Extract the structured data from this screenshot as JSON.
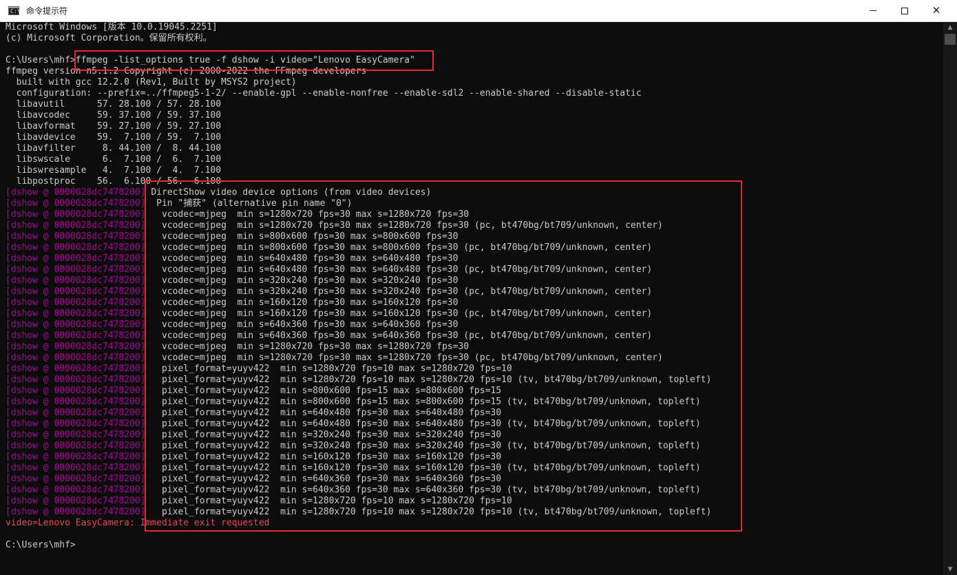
{
  "window": {
    "title": "命令提示符",
    "icon": "cmd-icon",
    "icon_glyph": "C:\\",
    "controls": {
      "minimize": "minimize-icon",
      "maximize": "maximize-icon",
      "close": "close-icon",
      "close_glyph": "✕"
    }
  },
  "colors": {
    "background": "#0c0c0c",
    "text": "#cccccc",
    "dshow_prefix": "#b4009e",
    "error": "#e74856",
    "highlight": "#e8292e"
  },
  "console": {
    "lines": [
      {
        "text": "Microsoft Windows [版本 10.0.19045.2251]"
      },
      {
        "text": "(c) Microsoft Corporation。保留所有权利。"
      },
      {
        "text": ""
      },
      {
        "text": "C:\\Users\\mhf>ffmpeg -list_options true -f dshow -i video=\"Lenovo EasyCamera\""
      },
      {
        "text": "ffmpeg version n5.1.2 Copyright (c) 2000-2022 the FFmpeg developers"
      },
      {
        "text": "  built with gcc 12.2.0 (Rev1, Built by MSYS2 project)"
      },
      {
        "text": "  configuration: --prefix=../ffmpeg5-1-2/ --enable-gpl --enable-nonfree --enable-sdl2 --enable-shared --disable-static"
      },
      {
        "text": "  libavutil      57. 28.100 / 57. 28.100"
      },
      {
        "text": "  libavcodec     59. 37.100 / 59. 37.100"
      },
      {
        "text": "  libavformat    59. 27.100 / 59. 27.100"
      },
      {
        "text": "  libavdevice    59.  7.100 / 59.  7.100"
      },
      {
        "text": "  libavfilter     8. 44.100 /  8. 44.100"
      },
      {
        "text": "  libswscale      6.  7.100 /  6.  7.100"
      },
      {
        "text": "  libswresample   4.  7.100 /  4.  7.100"
      },
      {
        "text": "  libpostproc    56.  6.100 / 56.  6.100"
      },
      {
        "prefix": "[dshow @ 0000028dc7478200]",
        "text": " DirectShow video device options (from video devices)"
      },
      {
        "prefix": "[dshow @ 0000028dc7478200]",
        "text": "  Pin \"捕获\" (alternative pin name \"0\")"
      },
      {
        "prefix": "[dshow @ 0000028dc7478200]",
        "text": "   vcodec=mjpeg  min s=1280x720 fps=30 max s=1280x720 fps=30"
      },
      {
        "prefix": "[dshow @ 0000028dc7478200]",
        "text": "   vcodec=mjpeg  min s=1280x720 fps=30 max s=1280x720 fps=30 (pc, bt470bg/bt709/unknown, center)"
      },
      {
        "prefix": "[dshow @ 0000028dc7478200]",
        "text": "   vcodec=mjpeg  min s=800x600 fps=30 max s=800x600 fps=30"
      },
      {
        "prefix": "[dshow @ 0000028dc7478200]",
        "text": "   vcodec=mjpeg  min s=800x600 fps=30 max s=800x600 fps=30 (pc, bt470bg/bt709/unknown, center)"
      },
      {
        "prefix": "[dshow @ 0000028dc7478200]",
        "text": "   vcodec=mjpeg  min s=640x480 fps=30 max s=640x480 fps=30"
      },
      {
        "prefix": "[dshow @ 0000028dc7478200]",
        "text": "   vcodec=mjpeg  min s=640x480 fps=30 max s=640x480 fps=30 (pc, bt470bg/bt709/unknown, center)"
      },
      {
        "prefix": "[dshow @ 0000028dc7478200]",
        "text": "   vcodec=mjpeg  min s=320x240 fps=30 max s=320x240 fps=30"
      },
      {
        "prefix": "[dshow @ 0000028dc7478200]",
        "text": "   vcodec=mjpeg  min s=320x240 fps=30 max s=320x240 fps=30 (pc, bt470bg/bt709/unknown, center)"
      },
      {
        "prefix": "[dshow @ 0000028dc7478200]",
        "text": "   vcodec=mjpeg  min s=160x120 fps=30 max s=160x120 fps=30"
      },
      {
        "prefix": "[dshow @ 0000028dc7478200]",
        "text": "   vcodec=mjpeg  min s=160x120 fps=30 max s=160x120 fps=30 (pc, bt470bg/bt709/unknown, center)"
      },
      {
        "prefix": "[dshow @ 0000028dc7478200]",
        "text": "   vcodec=mjpeg  min s=640x360 fps=30 max s=640x360 fps=30"
      },
      {
        "prefix": "[dshow @ 0000028dc7478200]",
        "text": "   vcodec=mjpeg  min s=640x360 fps=30 max s=640x360 fps=30 (pc, bt470bg/bt709/unknown, center)"
      },
      {
        "prefix": "[dshow @ 0000028dc7478200]",
        "text": "   vcodec=mjpeg  min s=1280x720 fps=30 max s=1280x720 fps=30"
      },
      {
        "prefix": "[dshow @ 0000028dc7478200]",
        "text": "   vcodec=mjpeg  min s=1280x720 fps=30 max s=1280x720 fps=30 (pc, bt470bg/bt709/unknown, center)"
      },
      {
        "prefix": "[dshow @ 0000028dc7478200]",
        "text": "   pixel_format=yuyv422  min s=1280x720 fps=10 max s=1280x720 fps=10"
      },
      {
        "prefix": "[dshow @ 0000028dc7478200]",
        "text": "   pixel_format=yuyv422  min s=1280x720 fps=10 max s=1280x720 fps=10 (tv, bt470bg/bt709/unknown, topleft)"
      },
      {
        "prefix": "[dshow @ 0000028dc7478200]",
        "text": "   pixel_format=yuyv422  min s=800x600 fps=15 max s=800x600 fps=15"
      },
      {
        "prefix": "[dshow @ 0000028dc7478200]",
        "text": "   pixel_format=yuyv422  min s=800x600 fps=15 max s=800x600 fps=15 (tv, bt470bg/bt709/unknown, topleft)"
      },
      {
        "prefix": "[dshow @ 0000028dc7478200]",
        "text": "   pixel_format=yuyv422  min s=640x480 fps=30 max s=640x480 fps=30"
      },
      {
        "prefix": "[dshow @ 0000028dc7478200]",
        "text": "   pixel_format=yuyv422  min s=640x480 fps=30 max s=640x480 fps=30 (tv, bt470bg/bt709/unknown, topleft)"
      },
      {
        "prefix": "[dshow @ 0000028dc7478200]",
        "text": "   pixel_format=yuyv422  min s=320x240 fps=30 max s=320x240 fps=30"
      },
      {
        "prefix": "[dshow @ 0000028dc7478200]",
        "text": "   pixel_format=yuyv422  min s=320x240 fps=30 max s=320x240 fps=30 (tv, bt470bg/bt709/unknown, topleft)"
      },
      {
        "prefix": "[dshow @ 0000028dc7478200]",
        "text": "   pixel_format=yuyv422  min s=160x120 fps=30 max s=160x120 fps=30"
      },
      {
        "prefix": "[dshow @ 0000028dc7478200]",
        "text": "   pixel_format=yuyv422  min s=160x120 fps=30 max s=160x120 fps=30 (tv, bt470bg/bt709/unknown, topleft)"
      },
      {
        "prefix": "[dshow @ 0000028dc7478200]",
        "text": "   pixel_format=yuyv422  min s=640x360 fps=30 max s=640x360 fps=30"
      },
      {
        "prefix": "[dshow @ 0000028dc7478200]",
        "text": "   pixel_format=yuyv422  min s=640x360 fps=30 max s=640x360 fps=30 (tv, bt470bg/bt709/unknown, topleft)"
      },
      {
        "prefix": "[dshow @ 0000028dc7478200]",
        "text": "   pixel_format=yuyv422  min s=1280x720 fps=10 max s=1280x720 fps=10"
      },
      {
        "prefix": "[dshow @ 0000028dc7478200]",
        "text": "   pixel_format=yuyv422  min s=1280x720 fps=10 max s=1280x720 fps=10 (tv, bt470bg/bt709/unknown, topleft)"
      },
      {
        "text": "video=Lenovo EasyCamera: Immediate exit requested",
        "style": "error"
      },
      {
        "text": ""
      },
      {
        "text": "C:\\Users\\mhf>"
      }
    ]
  },
  "scrollbar": {
    "up_glyph": "▲",
    "down_glyph": "▼"
  }
}
